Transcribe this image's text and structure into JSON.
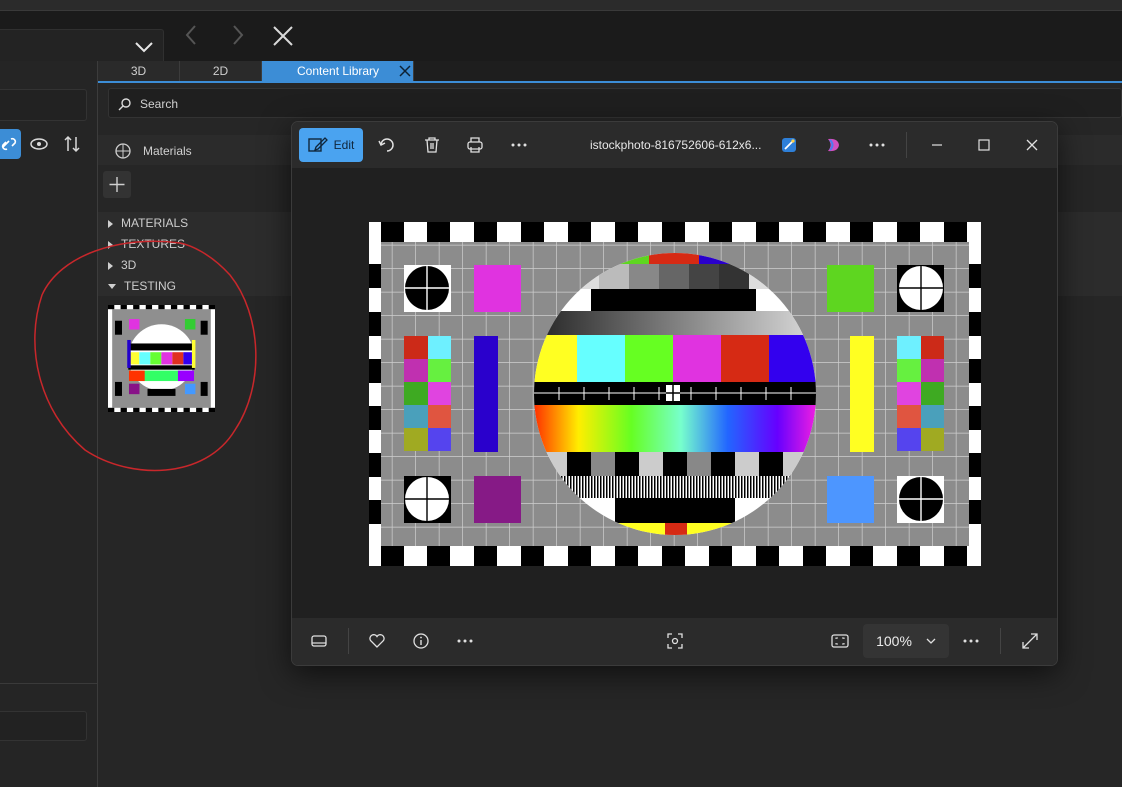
{
  "app": {
    "tabs": [
      {
        "label": "3D"
      },
      {
        "label": "2D"
      },
      {
        "label": "Content Library"
      }
    ],
    "search": {
      "label": "Search"
    },
    "materials_header": {
      "label": "Materials"
    },
    "tree": [
      {
        "label": "MATERIALS",
        "expanded": false
      },
      {
        "label": "TEXTURES",
        "expanded": false
      },
      {
        "label": "3D",
        "expanded": false
      },
      {
        "label": "TESTING",
        "expanded": true
      }
    ]
  },
  "viewer": {
    "edit_label": "Edit",
    "filename": "istockphoto-816752606-612x6...",
    "zoom": "100%",
    "accent": "#4aa3f0",
    "icons": [
      "edit-icon",
      "rotate-icon",
      "delete-icon",
      "print-icon",
      "more-icon",
      "designer-icon",
      "copilot-icon",
      "minimize-icon",
      "maximize-icon",
      "close-icon",
      "filmstrip-icon",
      "favorite-icon",
      "info-icon",
      "visual-search-icon",
      "fit-icon",
      "fullscreen-icon"
    ]
  },
  "colors": {
    "accent": "#3c8dd6",
    "annotation": "#c8272b"
  }
}
